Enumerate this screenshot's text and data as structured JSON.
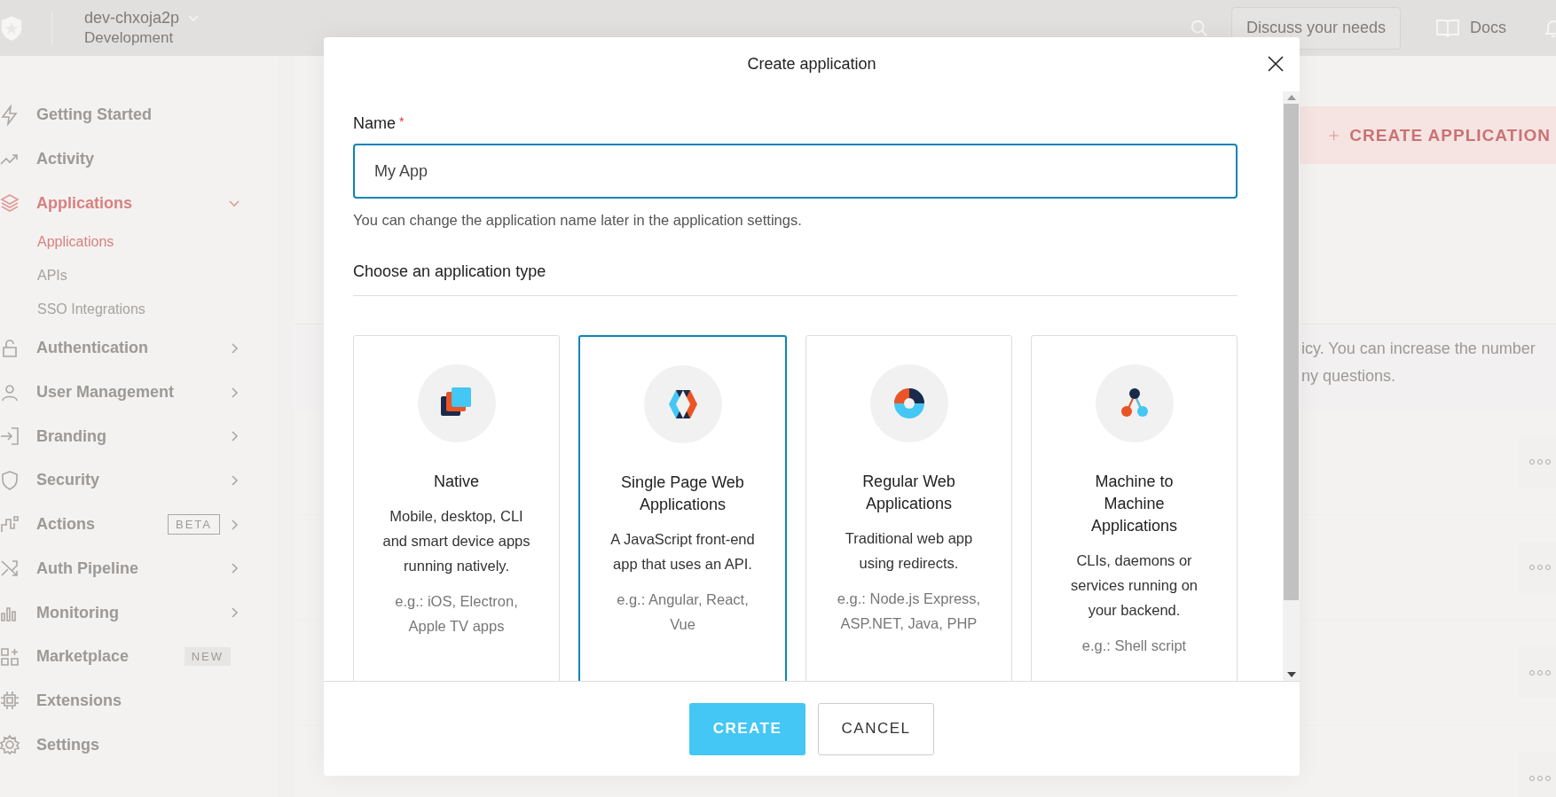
{
  "topbar": {
    "tenant": "dev-chxoja2p",
    "environment": "Development",
    "discuss_button": "Discuss your needs",
    "docs_link": "Docs"
  },
  "sidebar": {
    "items": [
      {
        "label": "Getting Started",
        "selected": false
      },
      {
        "label": "Activity",
        "selected": false
      },
      {
        "label": "Applications",
        "selected": true,
        "expanded": true,
        "children": [
          {
            "label": "Applications",
            "selected": true
          },
          {
            "label": "APIs",
            "selected": false
          },
          {
            "label": "SSO Integrations",
            "selected": false
          }
        ]
      },
      {
        "label": "Authentication",
        "selected": false,
        "expanded": false
      },
      {
        "label": "User Management",
        "selected": false,
        "expanded": false
      },
      {
        "label": "Branding",
        "selected": false,
        "expanded": false
      },
      {
        "label": "Security",
        "selected": false,
        "expanded": false
      },
      {
        "label": "Actions",
        "selected": false,
        "expanded": false,
        "badge": {
          "text": "BETA",
          "kind": "outline"
        }
      },
      {
        "label": "Auth Pipeline",
        "selected": false,
        "expanded": false
      },
      {
        "label": "Monitoring",
        "selected": false,
        "expanded": false
      },
      {
        "label": "Marketplace",
        "selected": false,
        "badge": {
          "text": "NEW",
          "kind": "filled"
        }
      },
      {
        "label": "Extensions",
        "selected": false
      },
      {
        "label": "Settings",
        "selected": false
      }
    ]
  },
  "content": {
    "create_button": "CREATE APPLICATION",
    "notice_lines": [
      "icy. You can increase the number",
      "ny questions."
    ]
  },
  "modal": {
    "title": "Create application",
    "name_field": {
      "label": "Name",
      "required_mark": "*",
      "value": "My App"
    },
    "help_text": "You can change the application name later in the application settings.",
    "section_heading": "Choose an application type",
    "app_types": [
      {
        "name": "Native",
        "description": "Mobile, desktop, CLI and smart device apps running natively.",
        "examples": "e.g.: iOS, Electron, Apple TV apps",
        "selected": false
      },
      {
        "name": "Single Page Web Applications",
        "description": "A JavaScript front-end app that uses an API.",
        "examples": "e.g.: Angular, React, Vue",
        "selected": true
      },
      {
        "name": "Regular Web Applications",
        "description": "Traditional web app using redirects.",
        "examples": "e.g.: Node.js Express, ASP.NET, Java, PHP",
        "selected": false
      },
      {
        "name": "Machine to Machine Applications",
        "description": "CLIs, daemons or services running on your backend.",
        "examples": "e.g.: Shell script",
        "selected": false
      }
    ],
    "create_button": "CREATE",
    "cancel_button": "CANCEL"
  }
}
